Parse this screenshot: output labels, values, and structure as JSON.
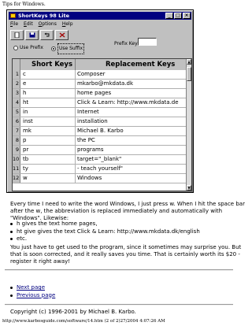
{
  "page": {
    "header": "Tips for Windows.",
    "footer": "http://www.karbosguide.com/software/14.htm (2 of 2)27/2004 4:07:26 AM"
  },
  "window": {
    "title": "ShortKeys 98 Lite",
    "title_color": "#000080",
    "controls": [
      "_",
      "□",
      "×"
    ],
    "menu": [
      "File",
      "Edit",
      "Options",
      "Help"
    ],
    "toolbar_icons": [
      "new-icon",
      "save-icon",
      "undo-icon",
      "delete-icon"
    ],
    "options": {
      "use_prefix": "Use Prefix",
      "use_suffix": "Use Suffix",
      "selected": "Use Suffix",
      "prefix_keys_label": "Prefix Keys",
      "prefix_keys_value": ""
    },
    "grid": {
      "headers": {
        "short": "Short Keys",
        "replacement": "Replacement Keys"
      },
      "rows": [
        {
          "n": "1",
          "short": "c",
          "repl": "Composer"
        },
        {
          "n": "2",
          "short": "e",
          "repl": "mkarbo@mkdata.dk"
        },
        {
          "n": "3",
          "short": "h",
          "repl": "home pages"
        },
        {
          "n": "4",
          "short": "ht",
          "repl": "Click & Learn: http://www.mkdata.de"
        },
        {
          "n": "5",
          "short": "in",
          "repl": "Internet"
        },
        {
          "n": "6",
          "short": "inst",
          "repl": "installation"
        },
        {
          "n": "7",
          "short": "mk",
          "repl": "Michael B. Karbo"
        },
        {
          "n": "8",
          "short": "p",
          "repl": "the PC"
        },
        {
          "n": "9",
          "short": "pr",
          "repl": "programs"
        },
        {
          "n": "10",
          "short": "tb",
          "repl": "target=\"_blank\""
        },
        {
          "n": "11",
          "short": "ty",
          "repl": "- teach yourself\""
        },
        {
          "n": "12",
          "short": "w",
          "repl": "Windows"
        }
      ]
    }
  },
  "article": {
    "p1": "Every time I need to write the word Windows, I just press w. When I hit the space bar after the w, the abbreviation is replaced immediately and automatically with \"Windows\". Likewise:",
    "bullets": [
      "h gives the text home pages,",
      "ht give gives the text Click & Learn: http://www.mkdata.dk/english",
      "etc."
    ],
    "p2": "You just have to get used to the program, since it sometimes may surprise you. But that is soon corrected, and it really saves you time. That is certainly worth its $20 - register it right away!",
    "nav": [
      "Next page",
      "Previous page"
    ],
    "copyright": "Copyright (c) 1996-2001 by Michael B. Karbo."
  }
}
